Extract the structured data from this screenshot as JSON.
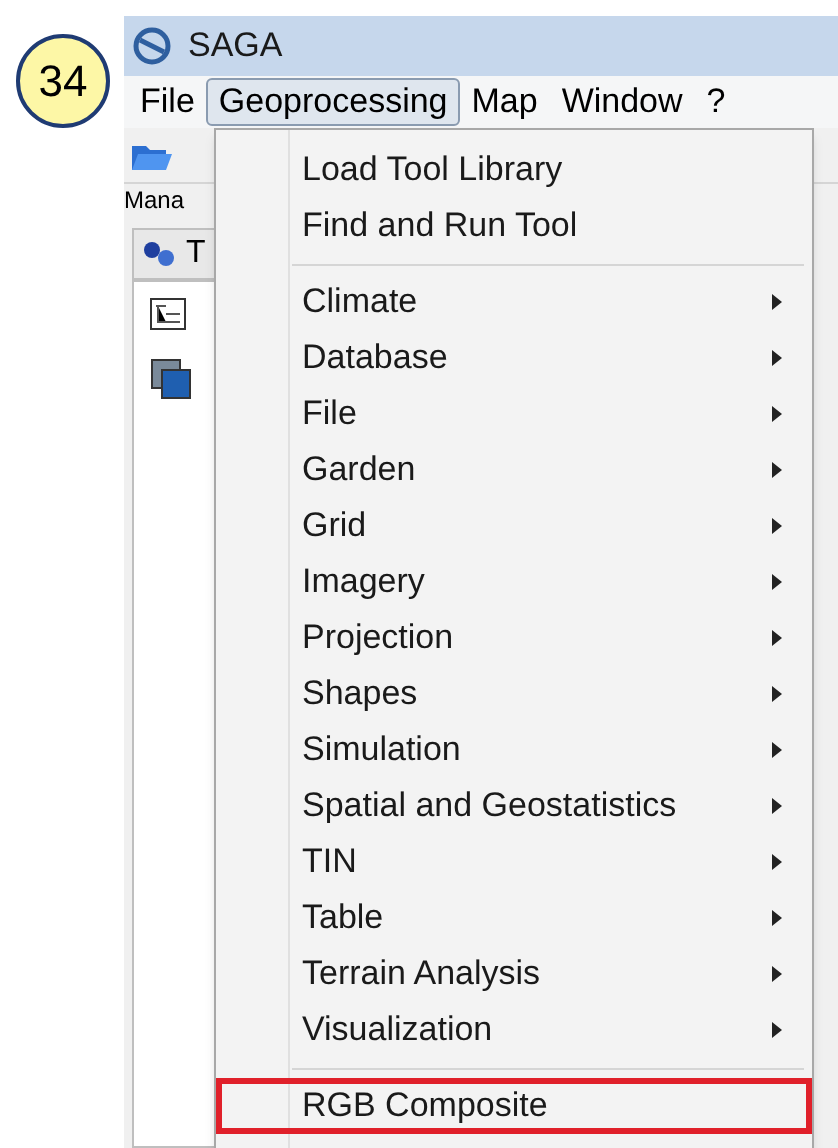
{
  "step_badge": "34",
  "window": {
    "title": "SAGA"
  },
  "menu_bar": [
    {
      "label": "File",
      "selected": false
    },
    {
      "label": "Geoprocessing",
      "selected": true
    },
    {
      "label": "Map",
      "selected": false
    },
    {
      "label": "Window",
      "selected": false
    },
    {
      "label": "?",
      "selected": false
    }
  ],
  "manager_label": "Mana",
  "manager_tab": {
    "label": "T"
  },
  "dropdown": [
    {
      "kind": "item",
      "label": "Load Tool Library",
      "highlighted": false
    },
    {
      "kind": "item",
      "label": "Find and Run Tool",
      "highlighted": false
    },
    {
      "kind": "separator"
    },
    {
      "kind": "submenu",
      "label": "Climate",
      "highlighted": false
    },
    {
      "kind": "submenu",
      "label": "Database",
      "highlighted": false
    },
    {
      "kind": "submenu",
      "label": "File",
      "highlighted": false
    },
    {
      "kind": "submenu",
      "label": "Garden",
      "highlighted": false
    },
    {
      "kind": "submenu",
      "label": "Grid",
      "highlighted": false
    },
    {
      "kind": "submenu",
      "label": "Imagery",
      "highlighted": false
    },
    {
      "kind": "submenu",
      "label": "Projection",
      "highlighted": false
    },
    {
      "kind": "submenu",
      "label": "Shapes",
      "highlighted": false
    },
    {
      "kind": "submenu",
      "label": "Simulation",
      "highlighted": false
    },
    {
      "kind": "submenu",
      "label": "Spatial and Geostatistics",
      "highlighted": false
    },
    {
      "kind": "submenu",
      "label": "TIN",
      "highlighted": false
    },
    {
      "kind": "submenu",
      "label": "Table",
      "highlighted": false
    },
    {
      "kind": "submenu",
      "label": "Terrain Analysis",
      "highlighted": false
    },
    {
      "kind": "submenu",
      "label": "Visualization",
      "highlighted": false
    },
    {
      "kind": "separator"
    },
    {
      "kind": "item",
      "label": "RGB Composite",
      "highlighted": true
    }
  ]
}
